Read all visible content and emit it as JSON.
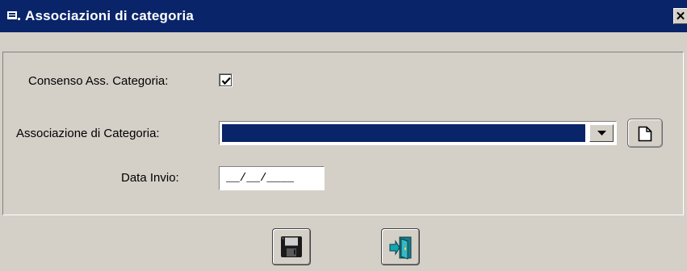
{
  "window": {
    "title": "Associazioni di categoria",
    "close_glyph": "✕",
    "icon": "form-icon"
  },
  "form": {
    "consenso_label": "Consenso Ass. Categoria:",
    "consenso_checked": true,
    "associazione_label": "Associazione di Categoria:",
    "associazione_value": "",
    "data_invio_label": "Data Invio:",
    "data_invio_value": "__/__/____"
  },
  "toolbar": {
    "save_icon": "floppy-disk-icon",
    "exit_icon": "exit-door-icon",
    "new_icon": "new-document-icon"
  },
  "colors": {
    "titlebar": "#0a246a",
    "face": "#d4d0c8",
    "selection": "#0a246a"
  }
}
